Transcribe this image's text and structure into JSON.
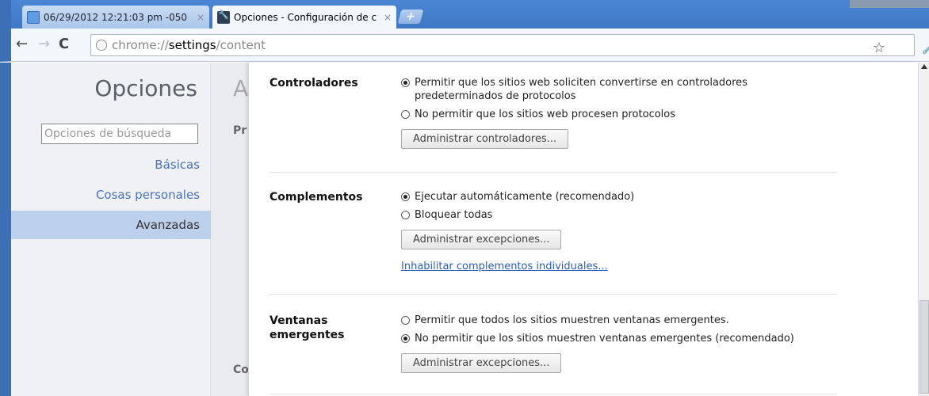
{
  "tabs": [
    {
      "title": "06/29/2012 12:21:03 pm -050",
      "close": "×"
    },
    {
      "title": "Opciones - Configuración de c",
      "close": "×"
    }
  ],
  "new_tab_label": "+",
  "toolbar": {
    "url_scheme": "chrome://",
    "url_host": "settings",
    "url_path": "/content",
    "back_glyph": "←",
    "forward_glyph": "→",
    "reload_glyph": "C",
    "star_glyph": "☆",
    "wrench_glyph": "🔧"
  },
  "sidebar": {
    "title": "Opciones",
    "search_placeholder": "Opciones de búsqueda",
    "items": [
      {
        "label": "Básicas"
      },
      {
        "label": "Cosas personales"
      },
      {
        "label": "Avanzadas",
        "selected": true
      }
    ]
  },
  "background_page": {
    "heading_fragment": "A",
    "section1_fragment": "Pr",
    "section2_fragment": "Co"
  },
  "content": {
    "sections": [
      {
        "label": "Controladores",
        "options": [
          {
            "text": "Permitir que los sitios web soliciten convertirse en controladores predeterminados de protocolos",
            "checked": true
          },
          {
            "text": "No permitir que los sitios web procesen protocolos",
            "checked": false
          }
        ],
        "button": "Administrar controladores..."
      },
      {
        "label": "Complementos",
        "options": [
          {
            "text": "Ejecutar automáticamente (recomendado)",
            "checked": true
          },
          {
            "text": "Bloquear todas",
            "checked": false
          }
        ],
        "button": "Administrar excepciones...",
        "link": "Inhabilitar complementos individuales..."
      },
      {
        "label": "Ventanas emergentes",
        "options": [
          {
            "text": "Permitir que todos los sitios muestren ventanas emergentes.",
            "checked": false
          },
          {
            "text": "No permitir que los sitios muestren ventanas emergentes (recomendado)",
            "checked": true
          }
        ],
        "button": "Administrar excepciones..."
      }
    ]
  }
}
